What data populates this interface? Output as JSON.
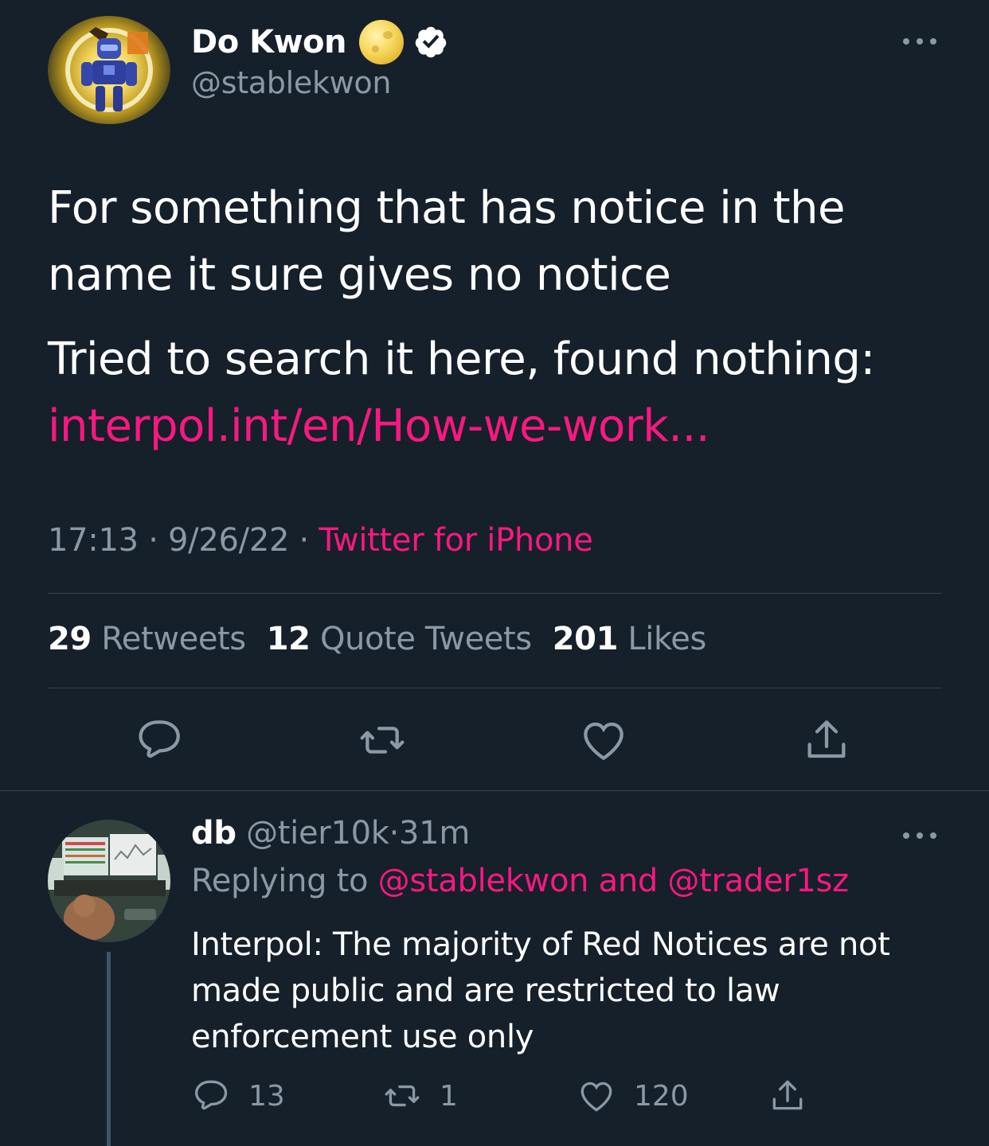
{
  "tweet": {
    "author": {
      "display_name": "Do Kwon",
      "handle": "@stablekwon",
      "verified": true
    },
    "text_line1": "For something that has notice in the name it sure gives no notice",
    "text_line2": "Tried to search it here, found nothing:",
    "link": "interpol.int/en/How-we-work...",
    "time": "17:13",
    "date": "9/26/22",
    "separator": " · ",
    "source": "Twitter for iPhone",
    "stats": {
      "retweets_count": "29",
      "retweets_label": "Retweets",
      "quotes_count": "12",
      "quotes_label": "Quote Tweets",
      "likes_count": "201",
      "likes_label": "Likes"
    },
    "actions": [
      "reply-icon",
      "retweet-icon",
      "like-icon",
      "share-icon"
    ]
  },
  "reply": {
    "display_name": "db",
    "handle": "@tier10k",
    "separator": "·",
    "age": "31m",
    "replying_prefix": "Replying to",
    "mention1": "@stablekwon",
    "and": "and",
    "mention2": "@trader1sz",
    "text": "Interpol: The majority of Red Notices are not made public and are restricted to law enforcement use only",
    "reply_count": "13",
    "retweet_count": "1",
    "like_count": "120"
  },
  "colors": {
    "background": "#15202b",
    "text": "#ffffff",
    "secondary": "#8b98a5",
    "accent_pink": "#f91880",
    "divider": "#38444d"
  }
}
